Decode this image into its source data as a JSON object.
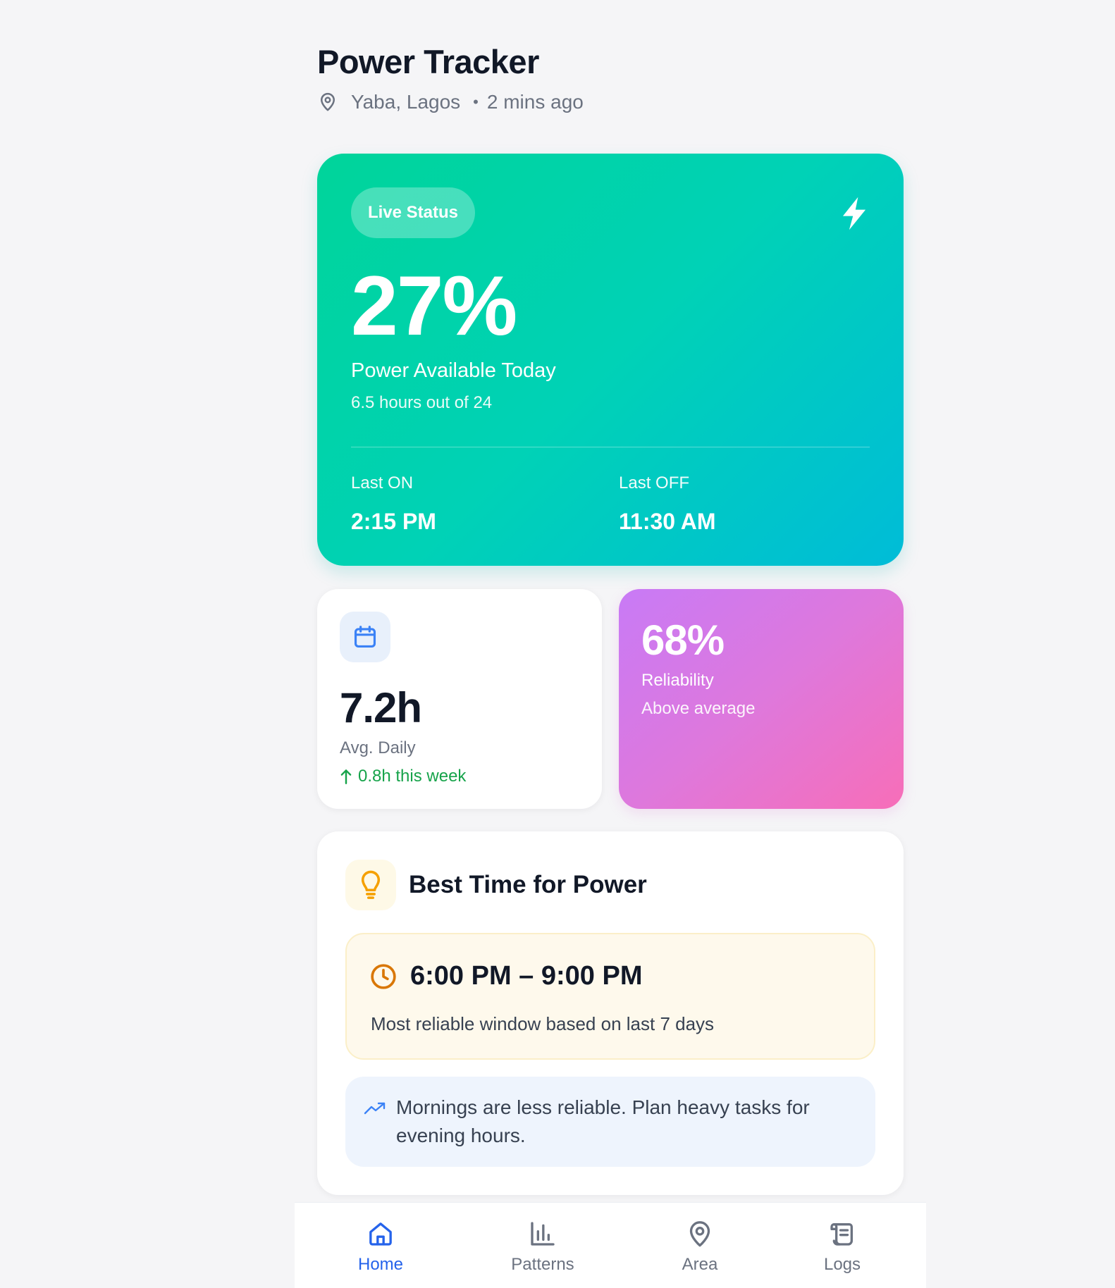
{
  "header": {
    "title": "Power Tracker",
    "location": "Yaba, Lagos",
    "separator": "•",
    "updated": "2 mins ago",
    "location_icon": "map-pin-icon"
  },
  "hero": {
    "badge": "Live Status",
    "icon": "lightning-bolt-icon",
    "percent": "27%",
    "label": "Power Available Today",
    "sublabel": "6.5 hours out of 24",
    "last_on_label": "Last ON",
    "last_on_value": "2:15 PM",
    "last_off_label": "Last OFF",
    "last_off_value": "11:30 AM",
    "gradient_colors": [
      "#00d49a",
      "#00bcd8"
    ]
  },
  "avg_daily": {
    "icon": "calendar-icon",
    "value": "7.2h",
    "label": "Avg. Daily",
    "trend_icon": "arrow-up-icon",
    "trend": "0.8h this week",
    "trend_color": "#16a34a"
  },
  "reliability": {
    "value": "68%",
    "label": "Reliability",
    "sublabel": "Above average",
    "gradient_colors": [
      "#c87af6",
      "#f76eb8"
    ]
  },
  "best_time": {
    "icon": "lightbulb-icon",
    "title": "Best Time for Power",
    "window_icon": "clock-icon",
    "window": "6:00 PM – 9:00 PM",
    "window_note": "Most reliable window based on last 7 days",
    "tip_icon": "trending-up-icon",
    "tip": "Mornings are less reliable. Plan heavy tasks for evening hours."
  },
  "nav": {
    "items": [
      {
        "label": "Home",
        "icon": "home-icon",
        "active": true
      },
      {
        "label": "Patterns",
        "icon": "bar-chart-icon",
        "active": false
      },
      {
        "label": "Area",
        "icon": "map-pin-icon",
        "active": false
      },
      {
        "label": "Logs",
        "icon": "scroll-icon",
        "active": false
      }
    ],
    "active_color": "#2563eb"
  }
}
